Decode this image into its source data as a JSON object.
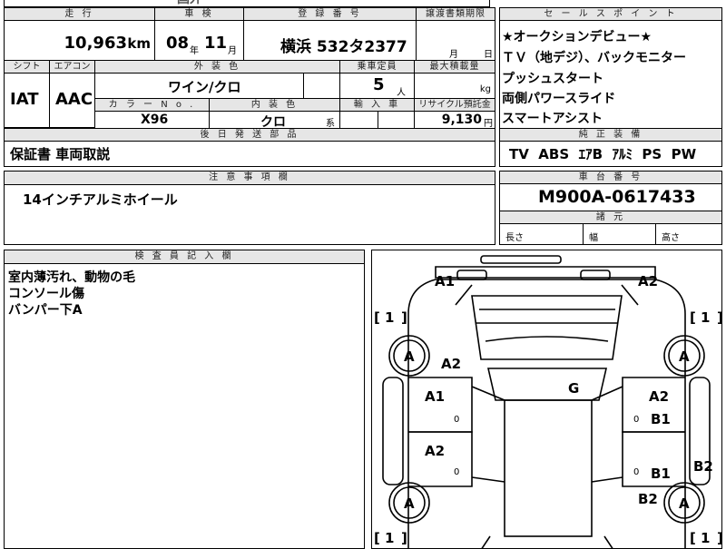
{
  "top_strip": {
    "fragment": "国外"
  },
  "headers": {
    "mileage": "走 行",
    "inspection": "車 検",
    "registration": "登 録 番 号",
    "transfer_deadline": "譲渡書類期限",
    "shift": "シフト",
    "aircon": "エアコン",
    "exterior_color": "外 装 色",
    "capacity": "乗車定員",
    "max_load": "最大積載量",
    "color_no": "カ ラ ー  N o .",
    "interior_color": "内 装 色",
    "import": "輸 入 車",
    "recycle": "リサイクル預託金",
    "later_parts": "後 日 発 送 部 品",
    "notes": "注 意 事 項 欄",
    "sales_points": "セ ー ル ス ポ イ ン ト",
    "equipment": "純 正 装 備",
    "chassis": "車 台 番 号",
    "dimensions": "諸 元",
    "inspector": "検 査 員 記 入 欄"
  },
  "vehicle": {
    "mileage_value": "10,963",
    "mileage_unit": "km",
    "inspection_year": "08",
    "inspection_year_unit": "年",
    "inspection_month": "11",
    "inspection_month_unit": "月",
    "plate": "横浜 532タ2377",
    "transfer_month_unit": "月",
    "transfer_day_unit": "日",
    "shift_value": "IAT",
    "aircon_value": "AAC",
    "exterior_color_value": "ワイン/クロ",
    "capacity_value": "5",
    "capacity_unit": "人",
    "max_load_unit": "kg",
    "color_no_value": "X96",
    "interior_color_value": "クロ",
    "interior_color_suffix": "系",
    "recycle_value": "9,130",
    "recycle_unit": "円",
    "later_parts_value": "保証書 車両取説",
    "notes_value": "14インチアルミホイール"
  },
  "sales_points": [
    "★オークションデビュー★",
    "ＴＶ（地デジ）、バックモニター",
    "プッシュスタート",
    "両側パワースライド",
    "スマートアシスト"
  ],
  "equipment_value": "TV  ABS  ｴｱB  ｱﾙﾐ  PS  PW",
  "chassis_value": "M900A-0617433",
  "dimensions": {
    "length": "長さ",
    "width": "幅",
    "height": "高さ"
  },
  "inspector_notes": [
    "室内薄汚れ、動物の毛",
    "コンソール傷",
    "バンパー下A"
  ],
  "diagram_marks": {
    "front_left_bumper": "A1",
    "front_right_bumper": "A2",
    "hood_left": "A2",
    "front_left_door": "A1",
    "rear_left_door": "A2",
    "roof": "G",
    "front_right_door_1": "A2",
    "front_right_door_2": "B1",
    "rear_right_door": "B1",
    "right_rocker": "B2",
    "rear_right_quarter": "B2",
    "wheel_fl": "A",
    "wheel_fr": "A",
    "wheel_rl": "A",
    "wheel_rr": "A",
    "tire_fl": "1",
    "tire_fr": "1",
    "tire_rl": "1",
    "tire_rr": "1",
    "zero_mark": "0"
  }
}
